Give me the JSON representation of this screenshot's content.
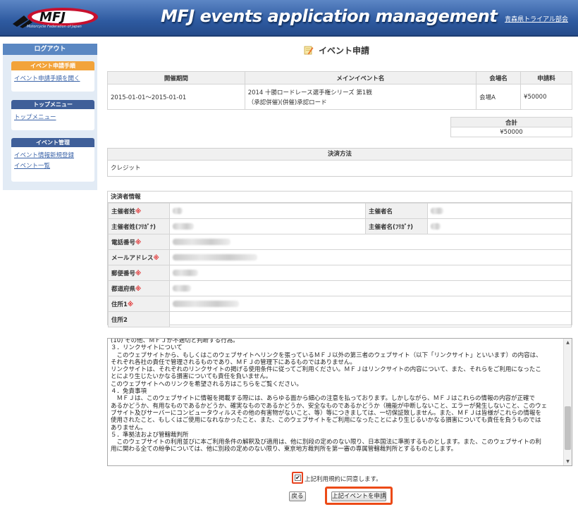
{
  "header": {
    "logo_text": "MFJ",
    "logo_subtitle": "Motorcycle Federation of Japan",
    "title": "MFJ events application management",
    "user_link": "青森県トライアル部会"
  },
  "sidebar": {
    "logout": "ログアウト",
    "sections": [
      {
        "title": "イベント申請手順",
        "links": [
          "イベント申請手順を開く"
        ]
      },
      {
        "title": "トップメニュー",
        "links": [
          "トップメニュー"
        ]
      },
      {
        "title": "イベント管理",
        "links": [
          "イベント情報新規登録",
          "イベント一覧"
        ]
      }
    ]
  },
  "page": {
    "title": "イベント申請"
  },
  "event_table": {
    "headers": [
      "開催期間",
      "メインイベント名",
      "会場名",
      "申請料"
    ],
    "row": {
      "period": "2015-01-01～2015-01-01",
      "event_name_line1": "2014 十勝ロードレース選手権シリーズ 第1戦",
      "event_name_line2": "（承認併催)(併催)承認ロード",
      "venue": "会場A",
      "fee": "¥50000"
    }
  },
  "total": {
    "label": "合計",
    "value": "¥50000"
  },
  "payment": {
    "label": "決済方法",
    "value": "クレジット"
  },
  "payer": {
    "title": "決済者情報",
    "fields": {
      "sei": "主催者姓",
      "mei": "主催者名",
      "sei_kana": "主催者姓(ﾌﾘｶﾞﾅ)",
      "mei_kana": "主催者名(ﾌﾘｶﾞﾅ)",
      "tel": "電話番号",
      "email": "メールアドレス",
      "zip": "郵便番号",
      "pref": "都道府県",
      "addr1": "住所1",
      "addr2": "住所2"
    },
    "required_mark": "※"
  },
  "terms": {
    "lines": [
      "(10) その他、ＭＦＪが不適切と判断する行為。",
      "",
      "３．リンクサイトについて",
      "　このウェブサイトから、もしくはこのウェブサイトへリンクを張っているＭＦＪ以外の第三者のウェブサイト（以下「リンクサイト」といいます）の内容は、",
      "それぞれ各社の責任で管理されるものであり、ＭＦＪの管理下にあるものではありません。",
      "リンクサイトは、それぞれのリンクサイトの掲げる使用条件に従ってご利用ください。ＭＦＪはリンクサイトの内容について、また、それらをご利用になったこ",
      "とにより生じたいかなる損害についても責任を負いません。",
      "このウェブサイトへのリンクを希望される方はこちらをご覧ください。",
      "",
      "４．免責事項",
      "　ＭＦＪは、このウェブサイトに情報を掲載する際には、あらゆる面から細心の注意を払っております。しかしながら、ＭＦＪはこれらの情報の内容が正確で",
      "あるかどうか、有用なものであるかどうか、確実なものであるかどうか、安全なものであるかどうか（機能が中断しないこと、エラーが発生しないこと、このウェ",
      "ブサイト及びサーバーにコンピュータウィルスその他の有害物がないこと、等）等につきましては、一切保証致しません。また、ＭＦＪは皆様がこれらの情報を",
      "使用されたこと、もしくはご使用になれなかったこと、また、このウェブサイトをご利用になったことにより生じるいかなる損害についても責任を負うものでは",
      "ありません。",
      "",
      "５．準拠法および管轄裁判所",
      "　このウェブサイトの利用並びに本ご利用条件の解釈及び適用は、他に別段の定めのない限り、日本国法に準拠するものとします。また、このウェブサイトの利",
      "用に関わる全ての紛争については、他に別段の定めのない限り、東京地方裁判所を第一審の専属管轄裁判所とするものとします。"
    ]
  },
  "agree": {
    "label": "上記利用規約に同意します。",
    "checked": true
  },
  "buttons": {
    "back": "戻る",
    "submit": "上記イベントを申請"
  },
  "colors": {
    "header_blue": "#2e5aa0",
    "highlight": "#ec4a17",
    "required": "#e03333"
  }
}
